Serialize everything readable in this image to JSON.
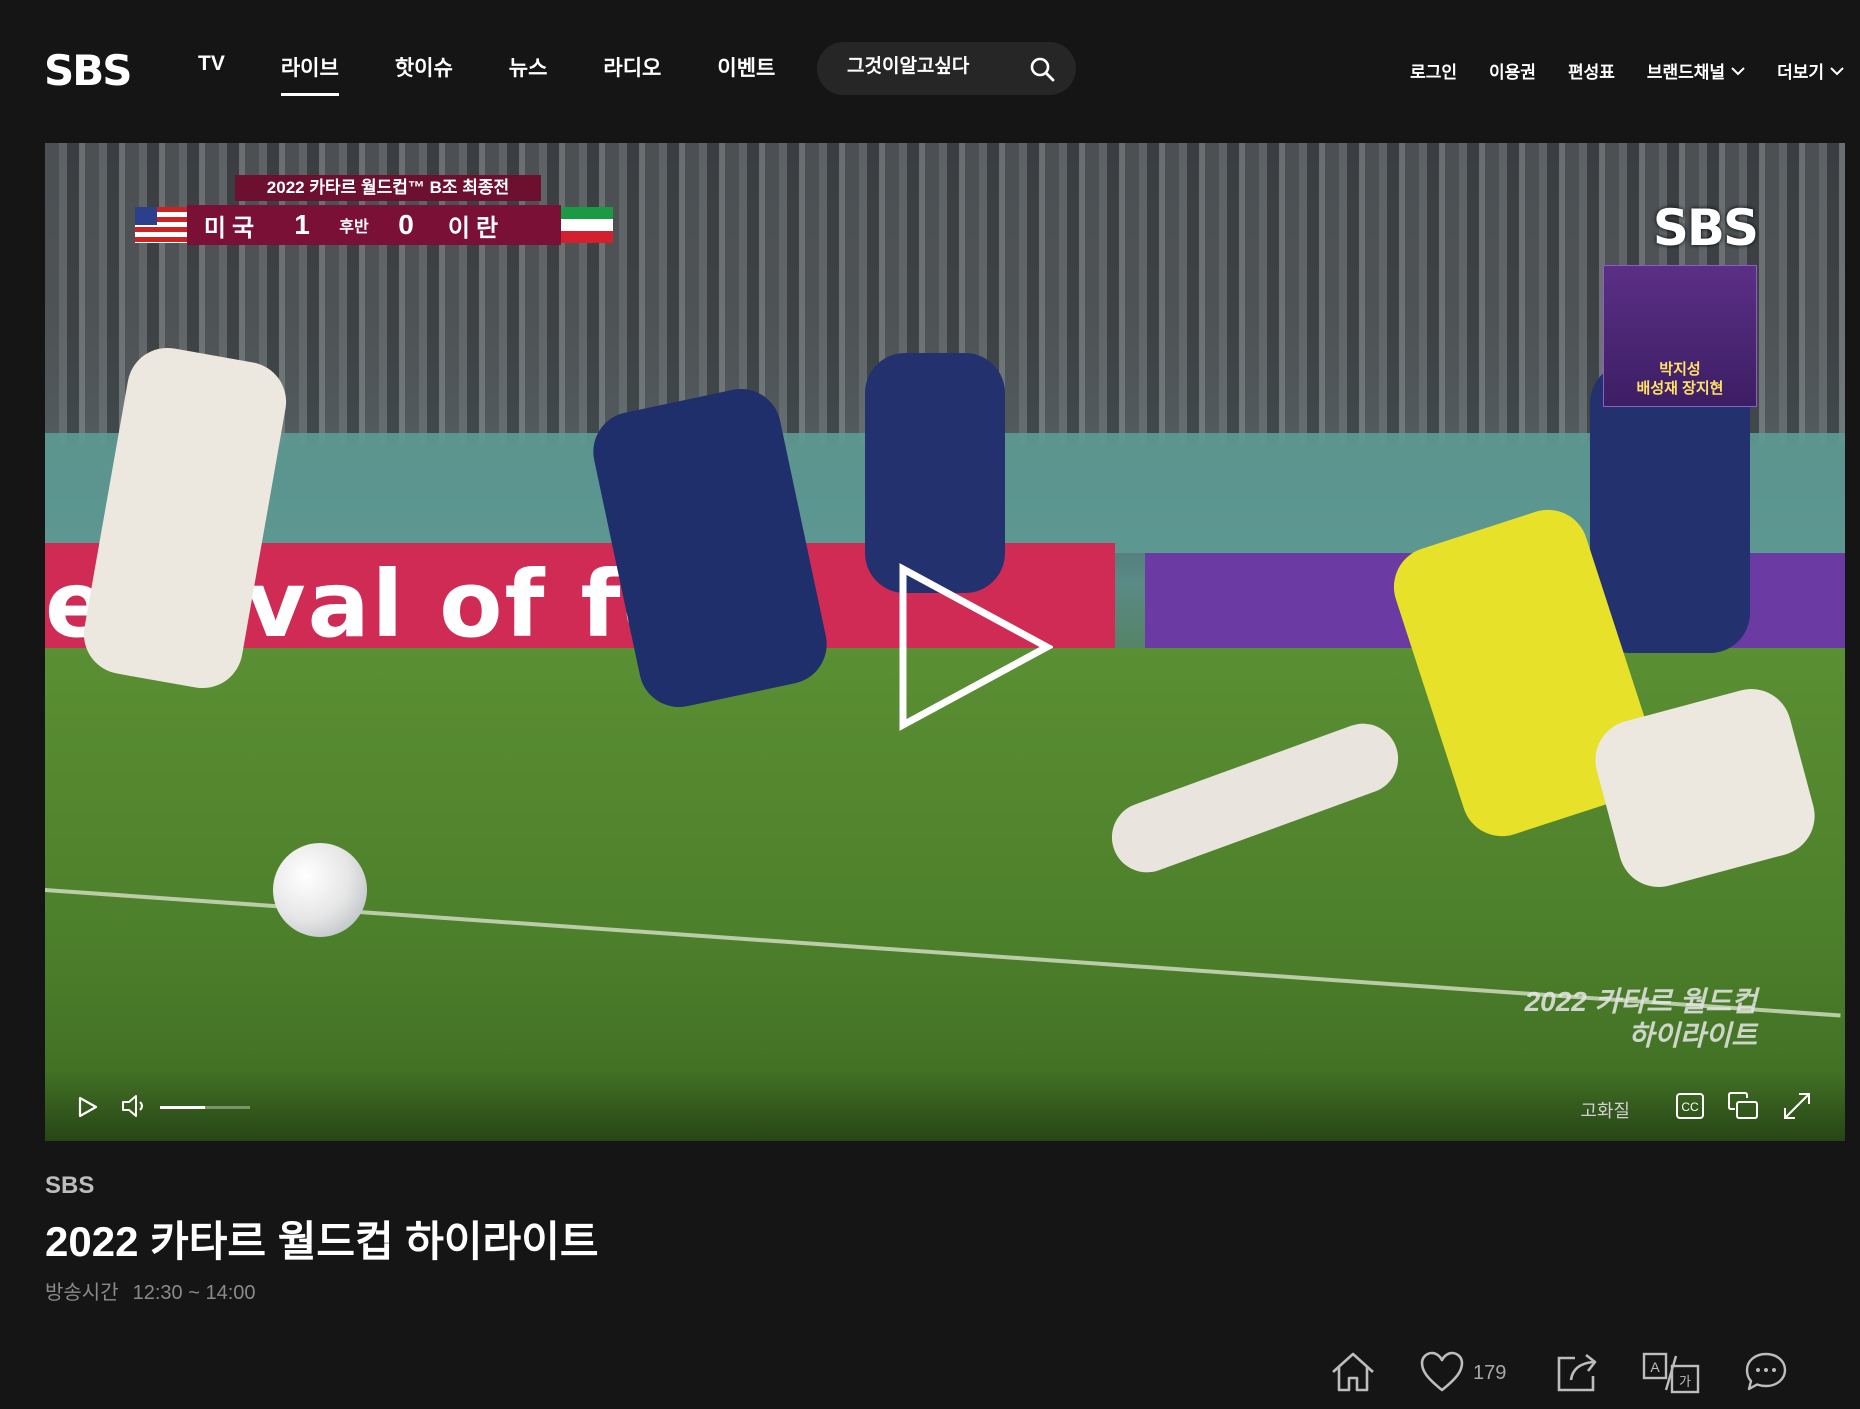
{
  "logo": "SBS",
  "nav": {
    "items": [
      "TV",
      "라이브",
      "핫이슈",
      "뉴스",
      "라디오",
      "이벤트"
    ],
    "active": "라이브"
  },
  "search": {
    "placeholder": "그것이알고싶다"
  },
  "util": {
    "login": "로그인",
    "pass": "이용권",
    "schedule": "편성표",
    "brand": "브랜드채널",
    "more": "더보기"
  },
  "video": {
    "score": {
      "tournament": "2022 카타르 월드컵™ B조 최종전",
      "team_left": "미국",
      "score_left": "1",
      "period": "후반",
      "score_right": "0",
      "team_right": "이란"
    },
    "banner": "estival of fo",
    "corner_logo": "SBS",
    "casters": [
      "박지성",
      "배성재 장지현"
    ],
    "watermark": [
      "2022 카타르 월드컵",
      "하이라이트"
    ],
    "volume": 0.5,
    "quality": "고화질"
  },
  "program": {
    "channel": "SBS",
    "title": "2022 카타르 월드컵 하이라이트",
    "airtime_label": "방송시간",
    "airtime": "12:30 ~ 14:00"
  },
  "actions": {
    "likes": "179"
  },
  "colors": {
    "background": "#151515",
    "score_bar": "#7a1036",
    "caster_text": "#ffe166"
  }
}
